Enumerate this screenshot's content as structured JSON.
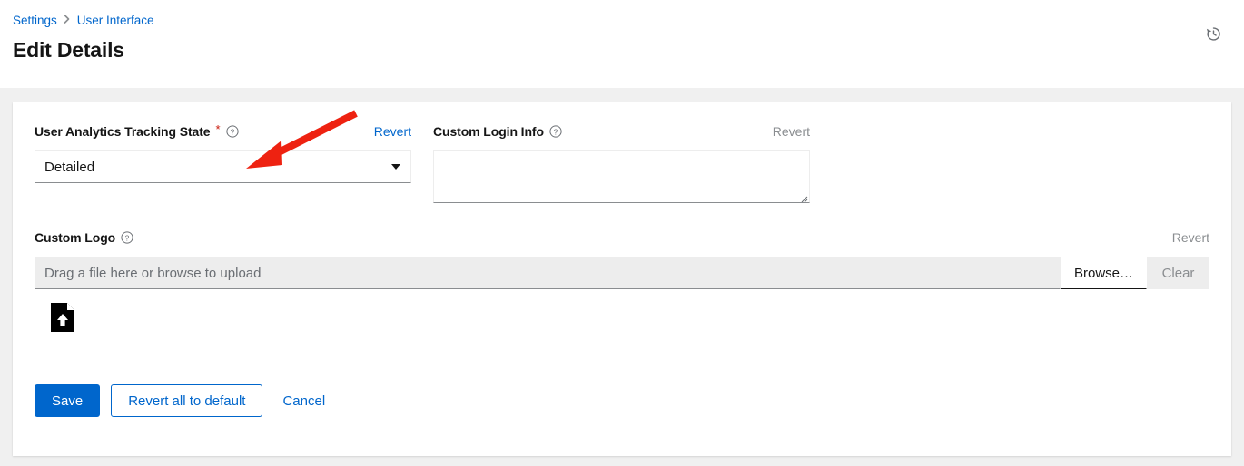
{
  "header": {
    "breadcrumb": {
      "items": [
        {
          "label": "Settings"
        },
        {
          "label": "User Interface"
        }
      ],
      "separator": "❯"
    },
    "title": "Edit Details",
    "history_icon": "history-icon"
  },
  "form": {
    "analytics": {
      "label": "User Analytics Tracking State",
      "required_marker": "*",
      "help_icon": "help-circle-icon",
      "revert_label": "Revert",
      "revert_enabled": true,
      "value": "Detailed",
      "options": [
        "Detailed"
      ]
    },
    "custom_login_info": {
      "label": "Custom Login Info",
      "help_icon": "help-circle-icon",
      "revert_label": "Revert",
      "revert_enabled": false,
      "value": "",
      "placeholder": ""
    },
    "custom_logo": {
      "label": "Custom Logo",
      "help_icon": "help-circle-icon",
      "revert_label": "Revert",
      "revert_enabled": false,
      "file_placeholder": "Drag a file here or browse to upload",
      "file_value": "",
      "browse_label": "Browse…",
      "clear_label": "Clear",
      "clear_enabled": false,
      "upload_icon": "file-upload-icon"
    }
  },
  "actions": {
    "save_label": "Save",
    "revert_all_label": "Revert all to default",
    "cancel_label": "Cancel"
  },
  "colors": {
    "accent_blue": "#0066cc",
    "required_red": "#c9190b",
    "disabled_gray": "#8a8d90",
    "page_background": "#f0f0f0",
    "annotation_red": "#ee2211"
  }
}
